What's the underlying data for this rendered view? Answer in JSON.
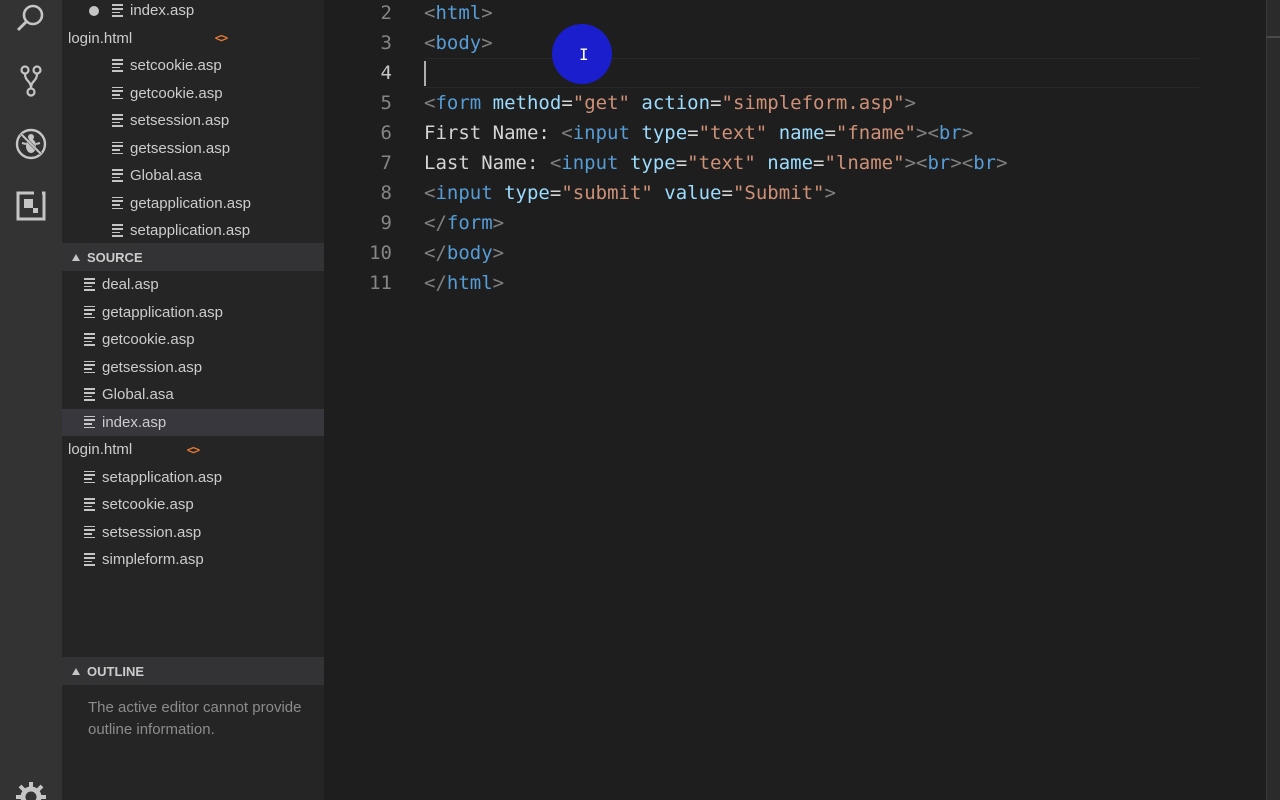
{
  "activity_bar": {
    "icons": [
      "search-icon",
      "source-control-icon",
      "debug-icon",
      "extensions-icon",
      "settings-gear-icon"
    ]
  },
  "explorer": {
    "open_editors": [
      {
        "name": "index.asp",
        "icon": "file-lines-icon",
        "modified": true
      },
      {
        "name": "login.html",
        "icon": "html-code-icon"
      },
      {
        "name": "setcookie.asp",
        "icon": "file-lines-icon"
      },
      {
        "name": "getcookie.asp",
        "icon": "file-lines-icon"
      },
      {
        "name": "setsession.asp",
        "icon": "file-lines-icon"
      },
      {
        "name": "getsession.asp",
        "icon": "file-lines-icon"
      },
      {
        "name": "Global.asa",
        "icon": "file-lines-icon"
      },
      {
        "name": "getapplication.asp",
        "icon": "file-lines-icon"
      },
      {
        "name": "setapplication.asp",
        "icon": "file-lines-icon"
      }
    ],
    "source_header": "SOURCE",
    "source_files": [
      {
        "name": "deal.asp",
        "icon": "file-lines-icon"
      },
      {
        "name": "getapplication.asp",
        "icon": "file-lines-icon"
      },
      {
        "name": "getcookie.asp",
        "icon": "file-lines-icon"
      },
      {
        "name": "getsession.asp",
        "icon": "file-lines-icon"
      },
      {
        "name": "Global.asa",
        "icon": "file-lines-icon"
      },
      {
        "name": "index.asp",
        "icon": "file-lines-icon",
        "selected": true
      },
      {
        "name": "login.html",
        "icon": "html-code-icon"
      },
      {
        "name": "setapplication.asp",
        "icon": "file-lines-icon"
      },
      {
        "name": "setcookie.asp",
        "icon": "file-lines-icon"
      },
      {
        "name": "setsession.asp",
        "icon": "file-lines-icon"
      },
      {
        "name": "simpleform.asp",
        "icon": "file-lines-icon"
      }
    ],
    "outline_header": "OUTLINE",
    "outline_message": "The active editor cannot provide outline information."
  },
  "editor": {
    "current_line": 4,
    "lines": [
      {
        "n": "2",
        "tokens": [
          [
            "b",
            "<"
          ],
          [
            "t",
            "html"
          ],
          [
            "b",
            ">"
          ]
        ]
      },
      {
        "n": "3",
        "tokens": [
          [
            "b",
            "<"
          ],
          [
            "t",
            "body"
          ],
          [
            "b",
            ">"
          ]
        ]
      },
      {
        "n": "4",
        "tokens": []
      },
      {
        "n": "5",
        "tokens": [
          [
            "b",
            "<"
          ],
          [
            "t",
            "form"
          ],
          [
            "x",
            " "
          ],
          [
            "a",
            "method"
          ],
          [
            "x",
            "="
          ],
          [
            "s",
            "\"get\""
          ],
          [
            "x",
            " "
          ],
          [
            "a",
            "action"
          ],
          [
            "x",
            "="
          ],
          [
            "s",
            "\"simpleform.asp\""
          ],
          [
            "b",
            ">"
          ]
        ]
      },
      {
        "n": "6",
        "tokens": [
          [
            "x",
            "First Name: "
          ],
          [
            "b",
            "<"
          ],
          [
            "t",
            "input"
          ],
          [
            "x",
            " "
          ],
          [
            "a",
            "type"
          ],
          [
            "x",
            "="
          ],
          [
            "s",
            "\"text\""
          ],
          [
            "x",
            " "
          ],
          [
            "a",
            "name"
          ],
          [
            "x",
            "="
          ],
          [
            "s",
            "\"fname\""
          ],
          [
            "b",
            "><"
          ],
          [
            "t",
            "br"
          ],
          [
            "b",
            ">"
          ]
        ]
      },
      {
        "n": "7",
        "tokens": [
          [
            "x",
            "Last Name: "
          ],
          [
            "b",
            "<"
          ],
          [
            "t",
            "input"
          ],
          [
            "x",
            " "
          ],
          [
            "a",
            "type"
          ],
          [
            "x",
            "="
          ],
          [
            "s",
            "\"text\""
          ],
          [
            "x",
            " "
          ],
          [
            "a",
            "name"
          ],
          [
            "x",
            "="
          ],
          [
            "s",
            "\"lname\""
          ],
          [
            "b",
            "><"
          ],
          [
            "t",
            "br"
          ],
          [
            "b",
            "><"
          ],
          [
            "t",
            "br"
          ],
          [
            "b",
            ">"
          ]
        ]
      },
      {
        "n": "8",
        "tokens": [
          [
            "b",
            "<"
          ],
          [
            "t",
            "input"
          ],
          [
            "x",
            " "
          ],
          [
            "a",
            "type"
          ],
          [
            "x",
            "="
          ],
          [
            "s",
            "\"submit\""
          ],
          [
            "x",
            " "
          ],
          [
            "a",
            "value"
          ],
          [
            "x",
            "="
          ],
          [
            "s",
            "\"Submit\""
          ],
          [
            "b",
            ">"
          ]
        ]
      },
      {
        "n": "9",
        "tokens": [
          [
            "b",
            "</"
          ],
          [
            "t",
            "form"
          ],
          [
            "b",
            ">"
          ]
        ]
      },
      {
        "n": "10",
        "tokens": [
          [
            "b",
            "</"
          ],
          [
            "t",
            "body"
          ],
          [
            "b",
            ">"
          ]
        ]
      },
      {
        "n": "11",
        "tokens": [
          [
            "b",
            "</"
          ],
          [
            "t",
            "html"
          ],
          [
            "b",
            ">"
          ]
        ]
      }
    ]
  },
  "colors": {
    "tag": "#569cd6",
    "attribute": "#9cdcfe",
    "string": "#ce9178",
    "bracket": "#808080",
    "mouse_highlight": "#1a1ee0"
  }
}
